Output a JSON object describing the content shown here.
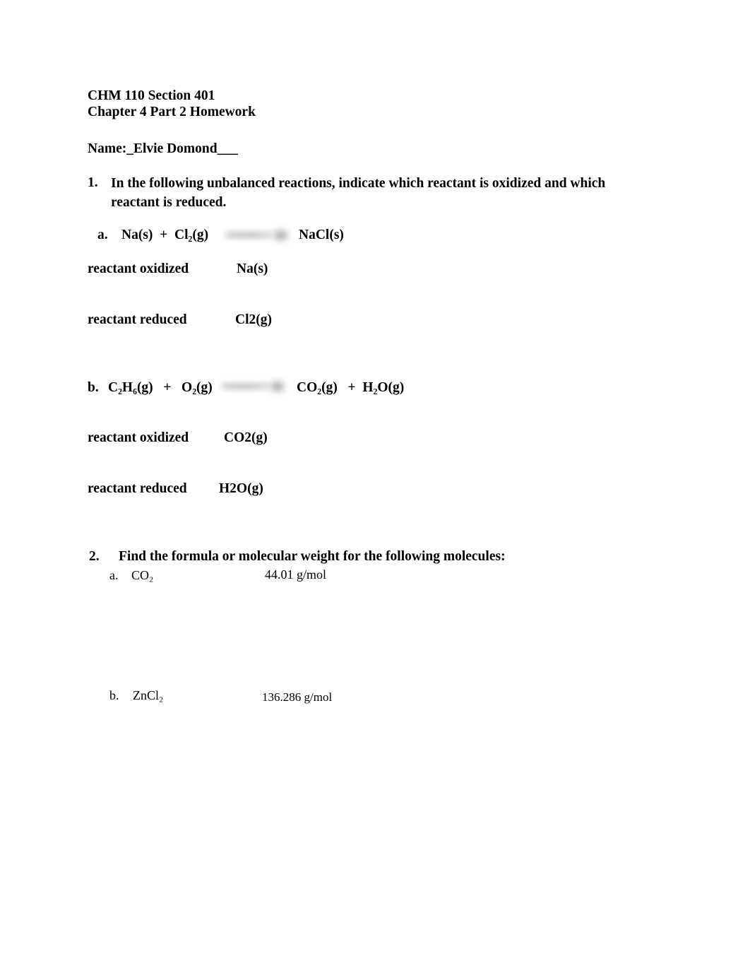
{
  "document": {
    "course_line": "CHM 110 Section 401",
    "assignment_line": "Chapter 4 Part 2 Homework",
    "name_line": "Name:_Elvie Domond___"
  },
  "questions": [
    {
      "number": "1.",
      "prompt": "In the following unbalanced reactions, indicate which reactant is oxidized and which reactant is reduced.",
      "parts": [
        {
          "label": "a.",
          "equation_left": "Na(s)  +  Cl₂(g)",
          "equation_right": "NaCl(s)",
          "arrow": "redacted-arrow",
          "oxidized_label": "reactant oxidized",
          "oxidized_value": "Na(s)",
          "reduced_label": "reactant reduced",
          "reduced_value": "Cl2(g)"
        },
        {
          "label": "b.",
          "equation_left": "C₂H₆(g)   +   O₂(g)",
          "equation_right": "CO₂(g)   +  H₂O(g)",
          "arrow": "redacted-arrow",
          "oxidized_label": "reactant oxidized",
          "oxidized_value": "CO2(g)",
          "reduced_label": "reactant reduced",
          "reduced_value": "H2O(g)"
        }
      ]
    },
    {
      "number": "2.",
      "prompt": "Find the formula or molecular weight for the following molecules:",
      "parts": [
        {
          "label": "a.",
          "formula": "CO₂",
          "value": "44.01 g/mol"
        },
        {
          "label": "b.",
          "formula": "ZnCl₂",
          "value": "136.286 g/mol"
        }
      ]
    }
  ],
  "colors": {
    "page_background": "#ffffff",
    "text": "#000000",
    "redaction_smudge": "#c4c4c4"
  }
}
